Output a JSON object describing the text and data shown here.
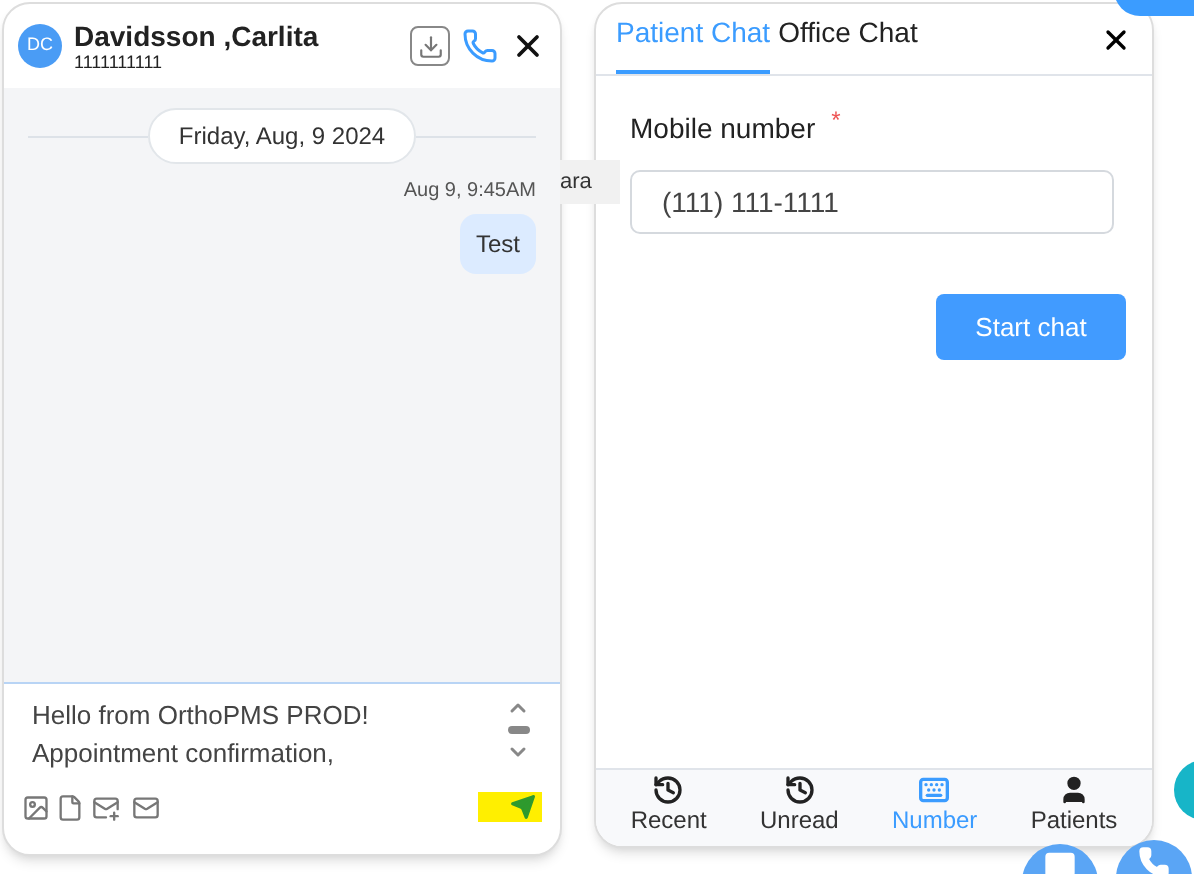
{
  "chat": {
    "avatar": "DC",
    "name": "Davidsson ,Carlita",
    "phone": "1111111111",
    "date": "Friday, Aug, 9 2024",
    "messages": [
      {
        "time": "Aug 9, 9:45AM",
        "text": "Test"
      }
    ],
    "compose": {
      "lines": [
        "Hello from OrthoPMS PROD!",
        "Appointment confirmation,"
      ]
    }
  },
  "background_fragment": "ara",
  "panel": {
    "tabs": [
      {
        "label": "Patient Chat",
        "selected": true
      },
      {
        "label": "Office Chat",
        "selected": false
      }
    ],
    "field": {
      "label": "Mobile number",
      "required_mark": "*",
      "value": "(111) 111-1111"
    },
    "button": "Start chat",
    "nav": [
      {
        "label": "Recent",
        "kind": "history",
        "selected": false
      },
      {
        "label": "Unread",
        "kind": "history",
        "selected": false
      },
      {
        "label": "Number",
        "kind": "keyboard",
        "selected": true
      },
      {
        "label": "Patients",
        "kind": "person",
        "selected": false
      }
    ]
  }
}
